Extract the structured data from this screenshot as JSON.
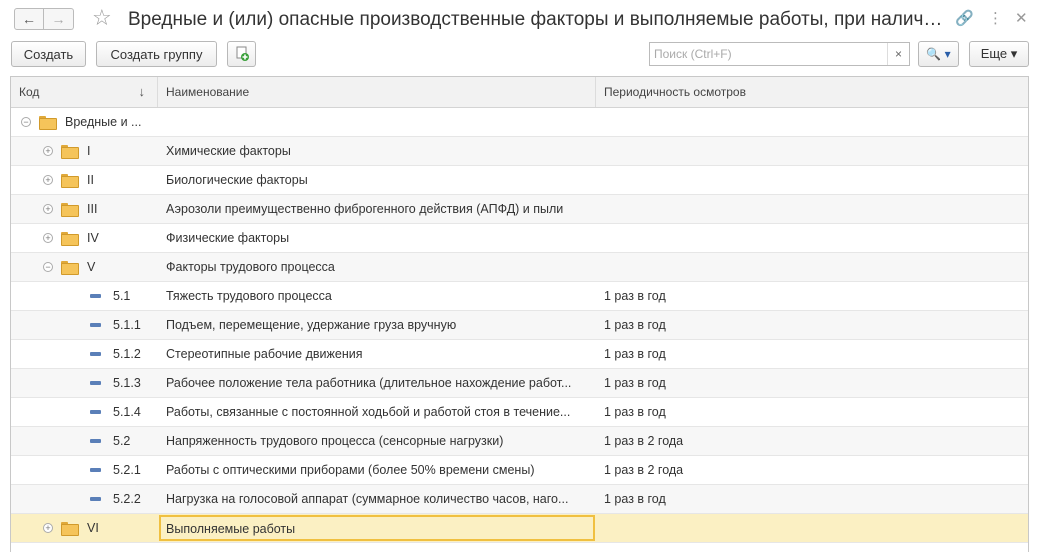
{
  "window": {
    "title": "Вредные и (или) опасные производственные факторы и выполняемые работы, при наличии которых проводятся обязательные предварительные и периодические медицинские осмотры",
    "icons": [
      "link-icon",
      "more-vertical-icon",
      "close-icon"
    ]
  },
  "nav": {
    "back": "←",
    "forward": "→"
  },
  "toolbar": {
    "create_label": "Создать",
    "create_group_label": "Создать группу",
    "search_placeholder": "Поиск (Ctrl+F)",
    "search_clear": "×",
    "search_button": "🔍 ▾",
    "more_label": "Еще ▾"
  },
  "columns": {
    "code": "Код",
    "name": "Наименование",
    "periodicity": "Периодичность осмотров",
    "sort_indicator": "↓"
  },
  "rows": [
    {
      "level": 0,
      "kind": "group",
      "expanded": true,
      "code": "Вредные и ...",
      "name": "",
      "periodicity": ""
    },
    {
      "level": 1,
      "kind": "group",
      "expanded": false,
      "code": "I",
      "name": "Химические факторы",
      "periodicity": ""
    },
    {
      "level": 1,
      "kind": "group",
      "expanded": false,
      "code": "II",
      "name": "Биологические факторы",
      "periodicity": ""
    },
    {
      "level": 1,
      "kind": "group",
      "expanded": false,
      "code": "III",
      "name": "Аэрозоли преимущественно фиброгенного действия (АПФД) и пыли",
      "periodicity": ""
    },
    {
      "level": 1,
      "kind": "group",
      "expanded": false,
      "code": "IV",
      "name": "Физические факторы",
      "periodicity": ""
    },
    {
      "level": 1,
      "kind": "group",
      "expanded": true,
      "code": "V",
      "name": "Факторы трудового процесса",
      "periodicity": ""
    },
    {
      "level": 2,
      "kind": "item",
      "code": "5.1",
      "name": "Тяжесть трудового процесса",
      "periodicity": "1 раз в год"
    },
    {
      "level": 2,
      "kind": "item",
      "code": "5.1.1",
      "name": "Подъем, перемещение, удержание груза вручную",
      "periodicity": "1 раз в год"
    },
    {
      "level": 2,
      "kind": "item",
      "code": "5.1.2",
      "name": "Стереотипные рабочие движения",
      "periodicity": "1 раз в год"
    },
    {
      "level": 2,
      "kind": "item",
      "code": "5.1.3",
      "name": "Рабочее положение тела работника (длительное нахождение работ...",
      "periodicity": "1 раз в год"
    },
    {
      "level": 2,
      "kind": "item",
      "code": "5.1.4",
      "name": "Работы, связанные с постоянной ходьбой и работой стоя в течение...",
      "periodicity": "1 раз в год"
    },
    {
      "level": 2,
      "kind": "item",
      "code": "5.2",
      "name": "Напряженность трудового процесса (сенсорные нагрузки)",
      "periodicity": "1 раз в 2 года"
    },
    {
      "level": 2,
      "kind": "item",
      "code": "5.2.1",
      "name": "Работы с оптическими приборами (более 50% времени смены)",
      "periodicity": "1 раз в 2 года"
    },
    {
      "level": 2,
      "kind": "item",
      "code": "5.2.2",
      "name": "Нагрузка на голосовой аппарат (суммарное количество часов, наго...",
      "periodicity": "1 раз в год"
    },
    {
      "level": 1,
      "kind": "group",
      "expanded": false,
      "selected": true,
      "code": "VI",
      "name": "Выполняемые работы",
      "periodicity": ""
    }
  ],
  "colors": {
    "selection": "#fbf0c3",
    "selection_border": "#f0c040",
    "folder": "#f5c45a",
    "element": "#5a7fb8"
  }
}
